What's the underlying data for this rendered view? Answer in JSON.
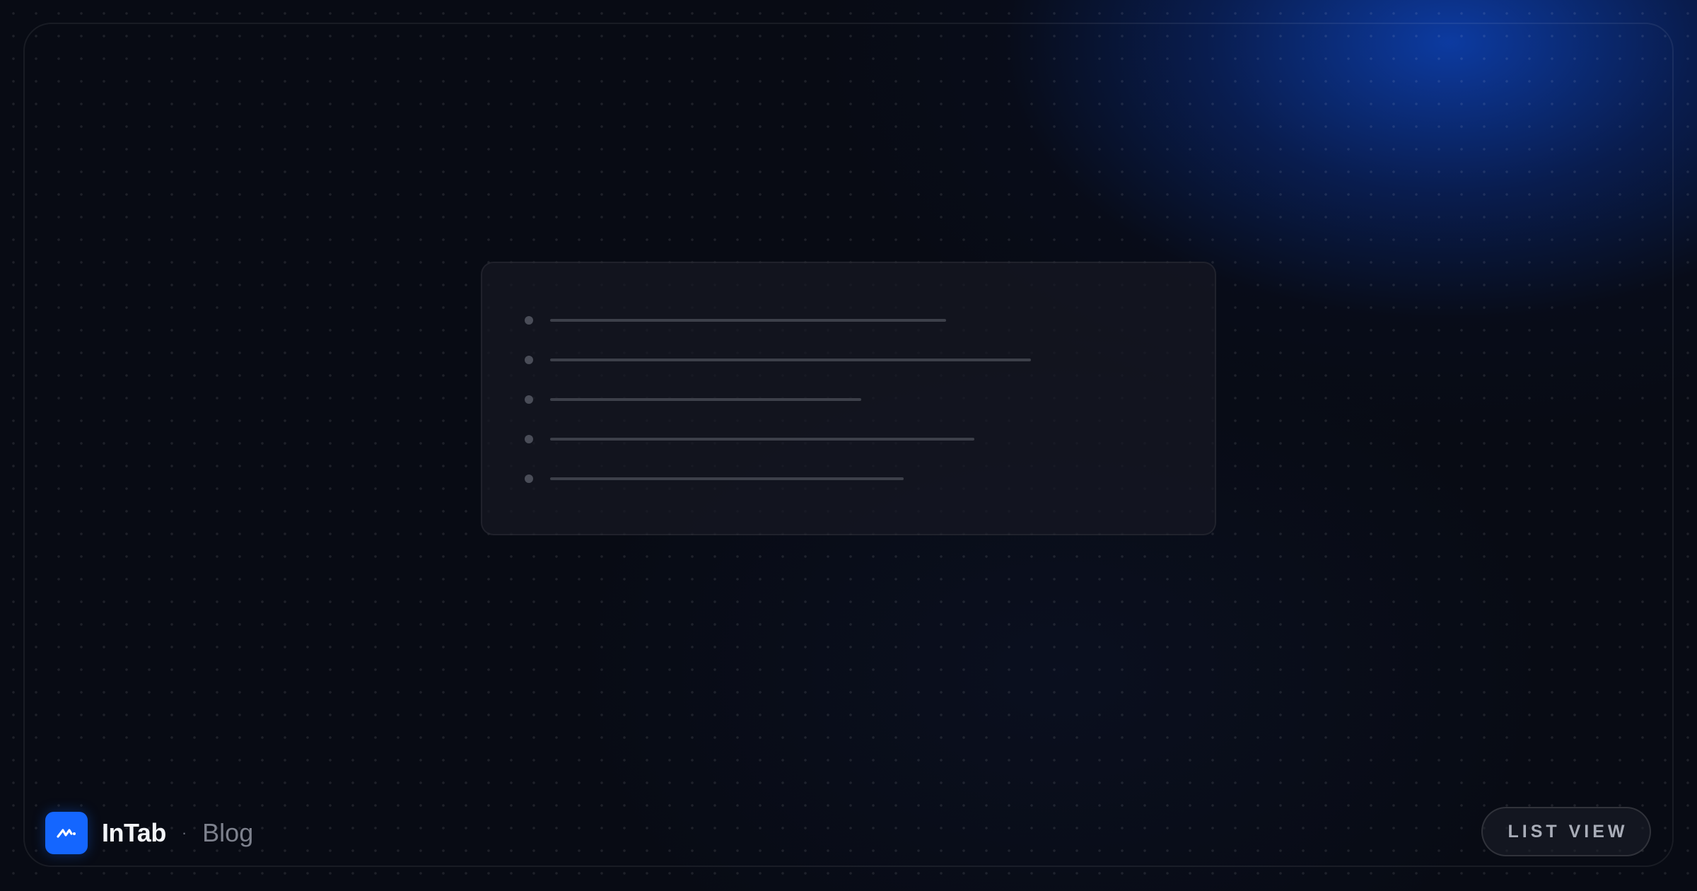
{
  "brand": {
    "name": "InTab",
    "separator": "·",
    "section": "Blog",
    "logo_icon": "wave-logo-icon",
    "accent_color": "#1466ff"
  },
  "preview_card": {
    "item_count": 5,
    "line_lengths_fraction": [
      0.56,
      0.68,
      0.44,
      0.6,
      0.5
    ]
  },
  "actions": {
    "list_view_label": "LIST VIEW"
  },
  "colors": {
    "background": "#080b14",
    "glow": "#0e48c8"
  }
}
